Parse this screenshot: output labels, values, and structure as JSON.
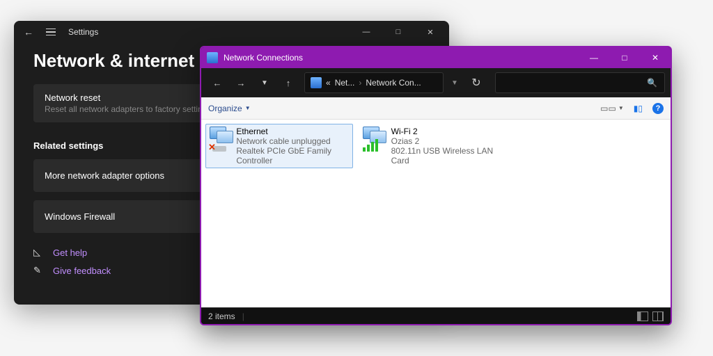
{
  "settings": {
    "app_title": "Settings",
    "page_title": "Network & internet",
    "cards": {
      "reset": {
        "title": "Network reset",
        "sub": "Reset all network adapters to factory settings"
      }
    },
    "related_heading": "Related settings",
    "related_items": [
      "More network adapter options",
      "Windows Firewall"
    ],
    "links": {
      "help": "Get help",
      "feedback": "Give feedback"
    }
  },
  "explorer": {
    "window_title": "Network Connections",
    "breadcrumb": {
      "seg1": "Net...",
      "seg2": "Network Con..."
    },
    "toolbar": {
      "organize": "Organize"
    },
    "adapters": [
      {
        "name": "Ethernet",
        "line2": "Network cable unplugged",
        "line3": "Realtek PCIe GbE Family Controller",
        "status": "disconnected",
        "selected": true
      },
      {
        "name": "Wi-Fi 2",
        "line2": "Ozias 2",
        "line3": "802.11n USB Wireless LAN Card",
        "status": "connected",
        "selected": false
      }
    ],
    "statusbar": {
      "count": "2 items"
    }
  }
}
